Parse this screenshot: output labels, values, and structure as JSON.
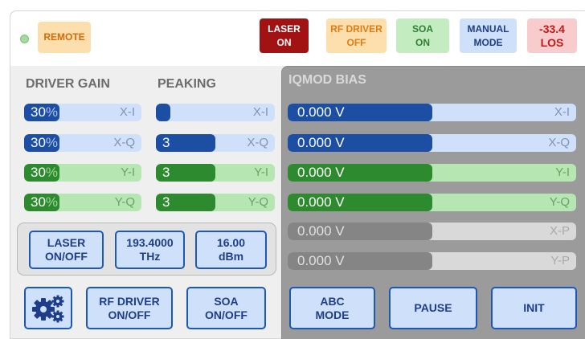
{
  "header": {
    "remote_label": "REMOTE",
    "laser_status": [
      "LASER",
      "ON"
    ],
    "rf_driver_status": [
      "RF DRIVER",
      "OFF"
    ],
    "soa_status": [
      "SOA",
      "ON"
    ],
    "mode_status": [
      "MANUAL",
      "MODE"
    ],
    "power_status": [
      "-33.4",
      "LOS"
    ]
  },
  "driver_gain": {
    "title": "DRIVER GAIN",
    "rows": [
      {
        "value": "30",
        "unit": "%",
        "label": "X-I",
        "level": 0.3
      },
      {
        "value": "30",
        "unit": "%",
        "label": "X-Q",
        "level": 0.3
      },
      {
        "value": "30",
        "unit": "%",
        "label": "Y-I",
        "level": 0.3
      },
      {
        "value": "30",
        "unit": "%",
        "label": "Y-Q",
        "level": 0.3
      }
    ]
  },
  "peaking": {
    "title": "PEAKING",
    "rows": [
      {
        "value": "1",
        "label": "X-I"
      },
      {
        "value": "3",
        "label": "X-Q"
      },
      {
        "value": "3",
        "label": "Y-I"
      },
      {
        "value": "3",
        "label": "Y-Q"
      }
    ]
  },
  "iqmod_bias": {
    "title": "IQMOD BIAS",
    "rows": [
      {
        "value": "0.000 V",
        "label": "X-I",
        "level": 0.5
      },
      {
        "value": "0.000 V",
        "label": "X-Q",
        "level": 0.5
      },
      {
        "value": "0.000 V",
        "label": "Y-I",
        "level": 0.5
      },
      {
        "value": "0.000 V",
        "label": "Y-Q",
        "level": 0.5
      },
      {
        "value": "0.000 V",
        "label": "X-P",
        "level": 0.5
      },
      {
        "value": "0.000 V",
        "label": "Y-P",
        "level": 0.5
      }
    ]
  },
  "laser_controls": {
    "onoff": [
      "LASER",
      "ON/OFF"
    ],
    "frequency": [
      "193.4000",
      "THz"
    ],
    "power": [
      "16.00",
      "dBm"
    ]
  },
  "bottom_buttons": {
    "rf_driver": [
      "RF DRIVER",
      "ON/OFF"
    ],
    "soa": [
      "SOA",
      "ON/OFF"
    ],
    "abc_mode": [
      "ABC",
      "MODE"
    ],
    "pause": "PAUSE",
    "init": "INIT"
  },
  "icons": {
    "settings": "gears-icon",
    "remote_led": "status-led-icon"
  },
  "colors": {
    "laser_on_bg": "#a31212",
    "rf_off_bg": "#fddfae",
    "soa_on_bg": "#c3ecc0",
    "mode_bg": "#cfe0fb",
    "los_bg": "#f8cccc",
    "accent_blue": "#1c4ea3",
    "accent_green": "#2d8a2f"
  }
}
